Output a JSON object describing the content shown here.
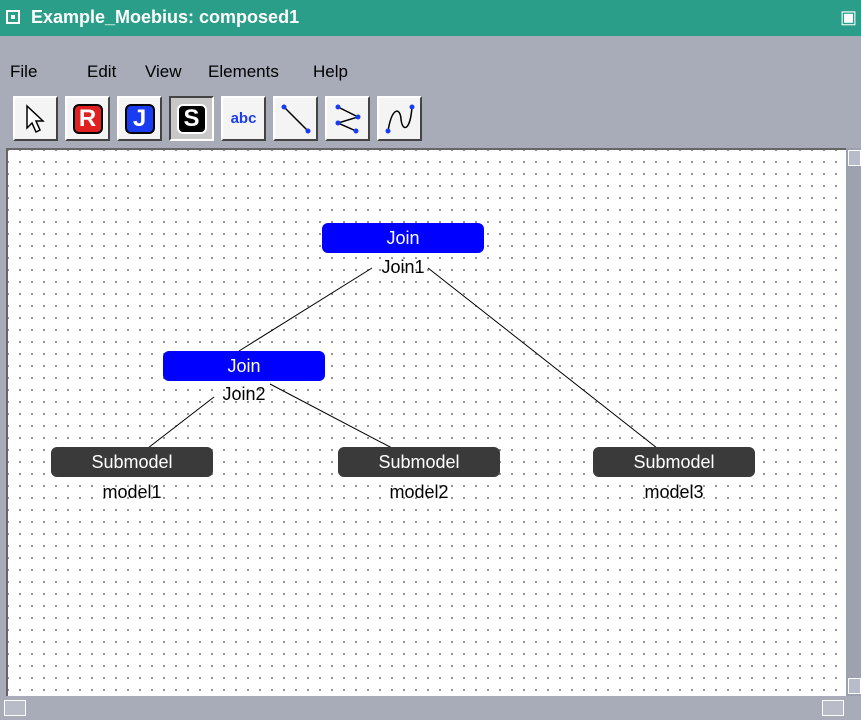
{
  "window": {
    "title": "Example_Moebius: composed1"
  },
  "menu": [
    "File",
    "Edit",
    "View",
    "Elements",
    "Help"
  ],
  "toolbar": {
    "tools": [
      {
        "name": "pointer-tool"
      },
      {
        "name": "rate-reward-tool",
        "glyph": "R",
        "color": "#e02020"
      },
      {
        "name": "join-tool",
        "glyph": "J",
        "color": "#1a3cf0"
      },
      {
        "name": "submodel-tool",
        "glyph": "S",
        "color": "#000000"
      },
      {
        "name": "text-tool",
        "glyph": "abc"
      },
      {
        "name": "line-tool"
      },
      {
        "name": "polyline-tool"
      },
      {
        "name": "curve-tool"
      }
    ]
  },
  "nodes": {
    "join1": {
      "type": "Join",
      "name": "Join1"
    },
    "join2": {
      "type": "Join",
      "name": "Join2"
    },
    "model1": {
      "type": "Submodel",
      "name": "model1"
    },
    "model2": {
      "type": "Submodel",
      "name": "model2"
    },
    "model3": {
      "type": "Submodel",
      "name": "model3"
    }
  },
  "colors": {
    "join": "#0000ff",
    "submodel": "#3a3a3a",
    "titlebar": "#2a9e88"
  }
}
